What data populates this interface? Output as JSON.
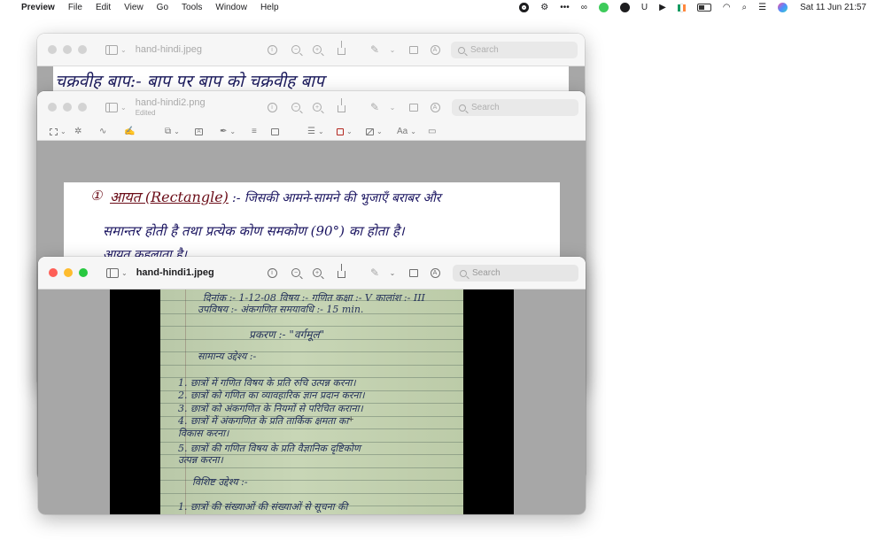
{
  "menubar": {
    "apple_glyph": "",
    "items": [
      "Preview",
      "File",
      "Edit",
      "View",
      "Go",
      "Tools",
      "Window",
      "Help"
    ],
    "status_icons": [
      "record-icon",
      "accessibility-icon",
      "more-icon",
      "creative-cloud-icon",
      "green-app-icon",
      "grammarly-icon",
      "u-app-icon",
      "play-icon",
      "flag-icon",
      "battery-icon",
      "wifi-icon",
      "search-icon",
      "control-center-icon",
      "siri-icon"
    ],
    "clock": "Sat 11 Jun  21:57"
  },
  "windows": {
    "back": {
      "title": "hand-hindi.jpeg",
      "search_placeholder": "Search",
      "handwriting": "चक्रवीह बाप:- बाप पर बाप को चक्रवीह बाप"
    },
    "middle": {
      "title": "hand-hindi2.png",
      "subtitle": "Edited",
      "search_placeholder": "Search",
      "markup_text_style": "Aa",
      "handwriting": {
        "line1_num": "①",
        "line1_term": "आयत (Rectangle)",
        "line1_rest": ":- जिसकी आमने-सामने की भुजाएँ बराबर और",
        "line2": "समान्तर होती है तथा प्रत्येक कोण समकोण (90°) का होता है।",
        "line3": "आयत कहलाता है।"
      },
      "accent_color": "#b3261e"
    },
    "front": {
      "title": "hand-hindi1.jpeg",
      "search_placeholder": "Search",
      "notebook_lines": [
        "दिनांक :- 1-12-08 विषय :- गणित  कक्षा :- V  कालांश :- III",
        "उपविषय :- अंकगणित  समयावधि :- 15 min.",
        "प्रकरण :- \"वर्गमूल\"",
        "सामान्य उद्देश्य :-",
        "1.  छात्रों में गणित विषय के प्रति रुचि उत्पन्न करना।",
        "2.  छात्रों को गणित का व्यावहारिक ज्ञान प्रदान करना।",
        "3.  छात्रों को अंकगणित के नियमों से परिचित कराना।",
        "4.  छात्रों में अंकगणित के प्रति तार्किक क्षमता का",
        "     विकास करना।",
        "5.  छात्रों की गणित विषय के प्रति वैज्ञानिक दृष्टिकोण",
        "     उत्पन्न करना।",
        "विशिष्ट उद्देश्य :-",
        "1.  छात्रों की संख्याओं की संख्याओं से सूचना की"
      ]
    }
  },
  "colors": {
    "traffic_red": "#fe5f57",
    "traffic_yellow": "#febc2e",
    "traffic_green": "#28c840"
  }
}
